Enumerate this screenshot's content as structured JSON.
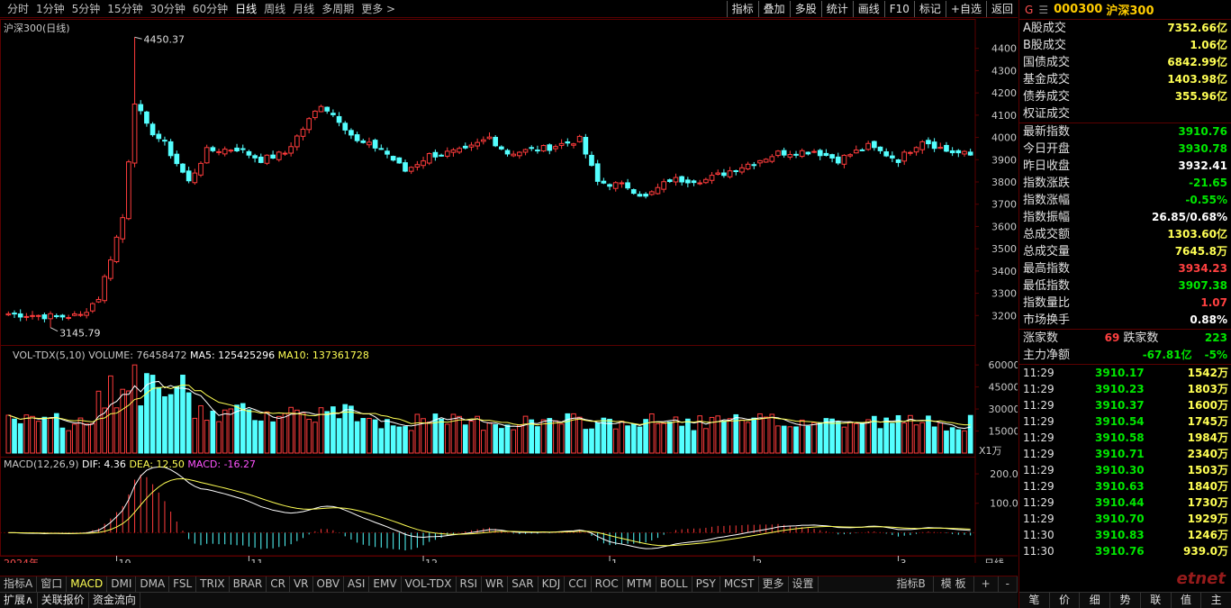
{
  "period_tabs": [
    "分时",
    "1分钟",
    "5分钟",
    "15分钟",
    "30分钟",
    "60分钟",
    "日线",
    "周线",
    "月线",
    "多周期",
    "更多 >"
  ],
  "active_period": "日线",
  "tool_tabs": [
    "指标",
    "叠加",
    "多股",
    "统计",
    "画线",
    "F10",
    "标记",
    "+自选",
    "返回"
  ],
  "kline_panel": {
    "label": "沪深300(日线)",
    "high_annotation": "4450.37",
    "low_annotation": "3145.79",
    "y_ticks": [
      "4400",
      "4300",
      "4200",
      "4100",
      "4000",
      "3900",
      "3800",
      "3700",
      "3600",
      "3500",
      "3400",
      "3300",
      "3200"
    ]
  },
  "vol_panel": {
    "name": "VOL-TDX(5,10)",
    "volume": "VOLUME: 76458472",
    "ma5": "MA5: 125425296",
    "ma10": "MA10: 137361728",
    "y_ticks": [
      "60000",
      "45000",
      "30000",
      "15000"
    ],
    "unit": "X1万"
  },
  "macd_panel": {
    "name": "MACD(12,26,9)",
    "dif": "DIF: 4.36",
    "dea": "DEA: 12.50",
    "macd": "MACD: -16.27",
    "y_ticks": [
      "200.0",
      "100.0"
    ]
  },
  "x_axis": {
    "year_label": "2024年",
    "months": [
      "10",
      "11",
      "12",
      "1",
      "2",
      "3"
    ],
    "period": "日线"
  },
  "indicator_tabs": [
    "指标A",
    "窗口",
    "MACD",
    "DMI",
    "DMA",
    "FSL",
    "TRIX",
    "BRAR",
    "CR",
    "VR",
    "OBV",
    "ASI",
    "EMV",
    "VOL-TDX",
    "RSI",
    "WR",
    "SAR",
    "KDJ",
    "CCI",
    "ROC",
    "MTM",
    "BOLL",
    "PSY",
    "MCST",
    "更多",
    "设置"
  ],
  "active_indicator": "MACD",
  "indicator_right": [
    "指标B",
    "模 板",
    "+",
    "-"
  ],
  "bottom_tabs": [
    "扩展∧",
    "关联报价",
    "资金流向"
  ],
  "right_panel": {
    "g_label": "G",
    "menu_glyph": "☰",
    "code": "000300",
    "name": "沪深300",
    "turnover_rows": [
      {
        "label": "A股成交",
        "value": "7352.66亿"
      },
      {
        "label": "B股成交",
        "value": "1.06亿"
      },
      {
        "label": "国债成交",
        "value": "6842.99亿"
      },
      {
        "label": "基金成交",
        "value": "1403.98亿"
      },
      {
        "label": "债券成交",
        "value": "355.96亿"
      },
      {
        "label": "权证成交",
        "value": ""
      }
    ],
    "index_rows": [
      {
        "label": "最新指数",
        "value": "3910.76",
        "color": "green"
      },
      {
        "label": "今日开盘",
        "value": "3930.78",
        "color": "green"
      },
      {
        "label": "昨日收盘",
        "value": "3932.41",
        "color": "white"
      },
      {
        "label": "指数涨跌",
        "value": "-21.65",
        "color": "green"
      },
      {
        "label": "指数涨幅",
        "value": "-0.55%",
        "color": "green"
      },
      {
        "label": "指数振幅",
        "value": "26.85/0.68%",
        "color": "white"
      },
      {
        "label": "总成交额",
        "value": "1303.60亿",
        "color": "yellow"
      },
      {
        "label": "总成交量",
        "value": "7645.8万",
        "color": "yellow"
      },
      {
        "label": "最高指数",
        "value": "3934.23",
        "color": "red"
      },
      {
        "label": "最低指数",
        "value": "3907.38",
        "color": "green"
      },
      {
        "label": "指数量比",
        "value": "1.07",
        "color": "red"
      },
      {
        "label": "市场换手",
        "value": "0.88%",
        "color": "white"
      }
    ],
    "breadth": {
      "up_label": "涨家数",
      "up_value": "69",
      "down_label": "跌家数",
      "down_value": "223"
    },
    "flow": {
      "label": "主力净额",
      "value": "-67.81亿",
      "pct": "-5%"
    },
    "ticks": [
      {
        "time": "11:29",
        "price": "3910.17",
        "vol": "1542万"
      },
      {
        "time": "11:29",
        "price": "3910.23",
        "vol": "1803万"
      },
      {
        "time": "11:29",
        "price": "3910.37",
        "vol": "1600万"
      },
      {
        "time": "11:29",
        "price": "3910.54",
        "vol": "1745万"
      },
      {
        "time": "11:29",
        "price": "3910.58",
        "vol": "1984万"
      },
      {
        "time": "11:29",
        "price": "3910.71",
        "vol": "2340万"
      },
      {
        "time": "11:29",
        "price": "3910.30",
        "vol": "1503万"
      },
      {
        "time": "11:29",
        "price": "3910.63",
        "vol": "1840万"
      },
      {
        "time": "11:29",
        "price": "3910.44",
        "vol": "1730万"
      },
      {
        "time": "11:29",
        "price": "3910.70",
        "vol": "1929万"
      },
      {
        "time": "11:30",
        "price": "3910.83",
        "vol": "1246万"
      },
      {
        "time": "11:30",
        "price": "3910.76",
        "vol": "939.0万"
      }
    ],
    "tabs": [
      "笔",
      "价",
      "细",
      "势",
      "联",
      "值",
      "主"
    ],
    "watermark": "etnet"
  },
  "colors": {
    "up": "#ff3c3c",
    "down": "#54ffff",
    "ma5": "#ffffff",
    "ma10": "#ffff54",
    "macd_label": "#ff54ff",
    "grid": "#5a0000"
  },
  "chart_data": {
    "type": "candlestick",
    "anchors": [
      [
        0,
        3208
      ],
      [
        8,
        3195
      ],
      [
        12,
        3200
      ],
      [
        15,
        3280
      ],
      [
        17,
        3460
      ],
      [
        19,
        3640
      ],
      [
        20,
        3900
      ],
      [
        21,
        4450
      ],
      [
        23,
        4050
      ],
      [
        26,
        3970
      ],
      [
        30,
        3800
      ],
      [
        33,
        3940
      ],
      [
        38,
        3950
      ],
      [
        42,
        3900
      ],
      [
        46,
        3930
      ],
      [
        52,
        4150
      ],
      [
        55,
        4080
      ],
      [
        58,
        3980
      ],
      [
        62,
        3950
      ],
      [
        66,
        3850
      ],
      [
        70,
        3920
      ],
      [
        76,
        3940
      ],
      [
        80,
        4000
      ],
      [
        83,
        3930
      ],
      [
        89,
        3950
      ],
      [
        95,
        3990
      ],
      [
        98,
        3800
      ],
      [
        103,
        3780
      ],
      [
        106,
        3730
      ],
      [
        110,
        3810
      ],
      [
        116,
        3810
      ],
      [
        120,
        3850
      ],
      [
        128,
        3930
      ],
      [
        134,
        3940
      ],
      [
        138,
        3900
      ],
      [
        143,
        3960
      ],
      [
        148,
        3900
      ],
      [
        152,
        3990
      ],
      [
        156,
        3940
      ],
      [
        160,
        3920
      ]
    ],
    "candle_count": 161,
    "ylim": [
      3100,
      4500
    ],
    "vol_ylim": [
      0,
      65000
    ],
    "macd_ylim": [
      -60,
      240
    ]
  }
}
